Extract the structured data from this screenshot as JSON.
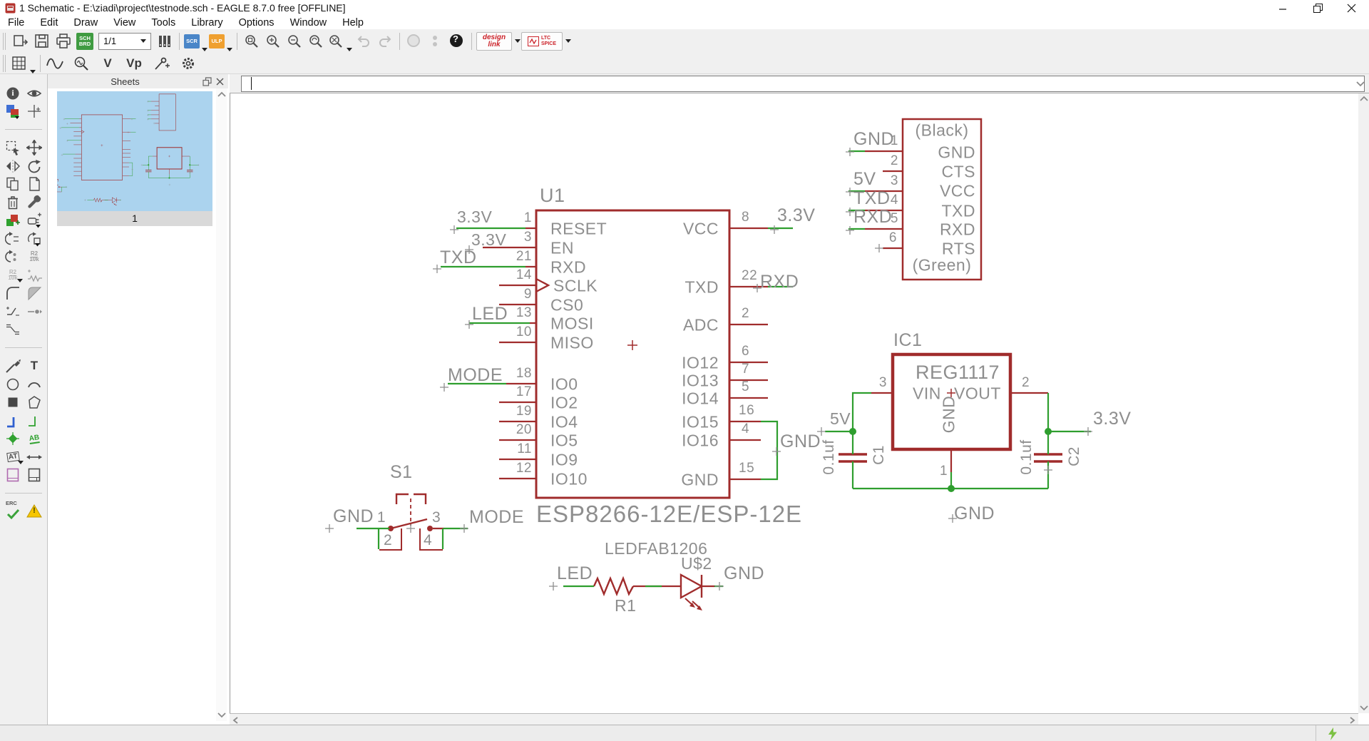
{
  "window": {
    "title": "1 Schematic - E:\\ziadi\\project\\testnode.sch - EAGLE 8.7.0 free [OFFLINE]"
  },
  "menu": {
    "items": [
      "File",
      "Edit",
      "Draw",
      "View",
      "Tools",
      "Library",
      "Options",
      "Window",
      "Help"
    ]
  },
  "toolbar": {
    "sheet_selector": "1/1",
    "schbrd_top": "SCH",
    "schbrd_bottom": "BRD",
    "scr": "SCR",
    "ulp": "ULP",
    "designlink": "design link",
    "ltc_top": "LTC",
    "ltc_bottom": "SPICE",
    "help_glyph": "?"
  },
  "tools": {
    "info_glyph": "i",
    "text_glyph": "T",
    "voltage_glyph": "V",
    "voltage_phase_glyph": "Vp",
    "value_top": "R2",
    "value_bottom": "10k",
    "label_glyph": "AB",
    "attribute_glyph": "AT",
    "erc_glyph": "ERC",
    "warning_glyph": "!"
  },
  "command_line": {
    "value": ""
  },
  "sheets_panel": {
    "title": "Sheets",
    "sheet_caption": "1"
  },
  "statusbar": {
    "text": ""
  },
  "colors": {
    "symbol_red": "#a02c2c",
    "net_green": "#2e9e2e",
    "label_gray": "#8e8e8e",
    "thumb_blue": "#abd3ee"
  },
  "schematic": {
    "u1": {
      "designator": "U1",
      "value": "ESP8266-12E/ESP-12E",
      "pins_left": [
        {
          "name": "RESET",
          "num": "1",
          "net": "3.3V"
        },
        {
          "name": "EN",
          "num": "3",
          "net": "3.3V"
        },
        {
          "name": "RXD",
          "num": "21",
          "net": "TXD"
        },
        {
          "name": "SCLK",
          "num": "14",
          "net": ""
        },
        {
          "name": "CS0",
          "num": "9",
          "net": ""
        },
        {
          "name": "MOSI",
          "num": "13",
          "net": "LED"
        },
        {
          "name": "MISO",
          "num": "10",
          "net": ""
        },
        {
          "name": "IO0",
          "num": "18",
          "net": "MODE"
        },
        {
          "name": "IO2",
          "num": "17",
          "net": ""
        },
        {
          "name": "IO4",
          "num": "19",
          "net": ""
        },
        {
          "name": "IO5",
          "num": "20",
          "net": ""
        },
        {
          "name": "IO9",
          "num": "11",
          "net": ""
        },
        {
          "name": "IO10",
          "num": "12",
          "net": ""
        }
      ],
      "pins_right": [
        {
          "name": "VCC",
          "num": "8",
          "net": "3.3V"
        },
        {
          "name": "TXD",
          "num": "22",
          "net": "RXD"
        },
        {
          "name": "ADC",
          "num": "2",
          "net": ""
        },
        {
          "name": "IO12",
          "num": "6",
          "net": ""
        },
        {
          "name": "IO13",
          "num": "7",
          "net": ""
        },
        {
          "name": "IO14",
          "num": "5",
          "net": ""
        },
        {
          "name": "IO15",
          "num": "16",
          "net": ""
        },
        {
          "name": "IO16",
          "num": "4",
          "net": ""
        },
        {
          "name": "GND",
          "num": "15",
          "net": ""
        }
      ],
      "gnd_net_label": "GND"
    },
    "connector": {
      "top_label": "(Black)",
      "bottom_label": "(Green)",
      "pins": [
        {
          "name": "GND",
          "num": "1",
          "net": "GND"
        },
        {
          "name": "CTS",
          "num": "2",
          "net": ""
        },
        {
          "name": "VCC",
          "num": "3",
          "net": "5V"
        },
        {
          "name": "TXD",
          "num": "4",
          "net": "TXD"
        },
        {
          "name": "RXD",
          "num": "5",
          "net": "RXD"
        },
        {
          "name": "RTS",
          "num": "6",
          "net": ""
        }
      ]
    },
    "regulator": {
      "designator": "IC1",
      "value": "REG1117",
      "pin_vin_name": "VIN",
      "pin_vin_num": "3",
      "pin_vout_name": "VOUT",
      "pin_vout_num": "2",
      "pin_gnd_name": "GND",
      "pin_gnd_num": "1",
      "net_in": "5V",
      "net_out": "3.3V",
      "net_gnd": "GND"
    },
    "c1": {
      "designator": "C1",
      "value": "0.1uf"
    },
    "c2": {
      "designator": "C2",
      "value": "0.1uf"
    },
    "switch": {
      "designator": "S1",
      "pin1": "1",
      "pin2": "2",
      "pin3": "3",
      "pin4": "4",
      "net_left": "GND",
      "net_right": "MODE"
    },
    "led": {
      "package_value": "LEDFAB1206",
      "designator": "U$2",
      "resistor_designator": "R1",
      "net_left": "LED",
      "net_right": "GND"
    }
  }
}
